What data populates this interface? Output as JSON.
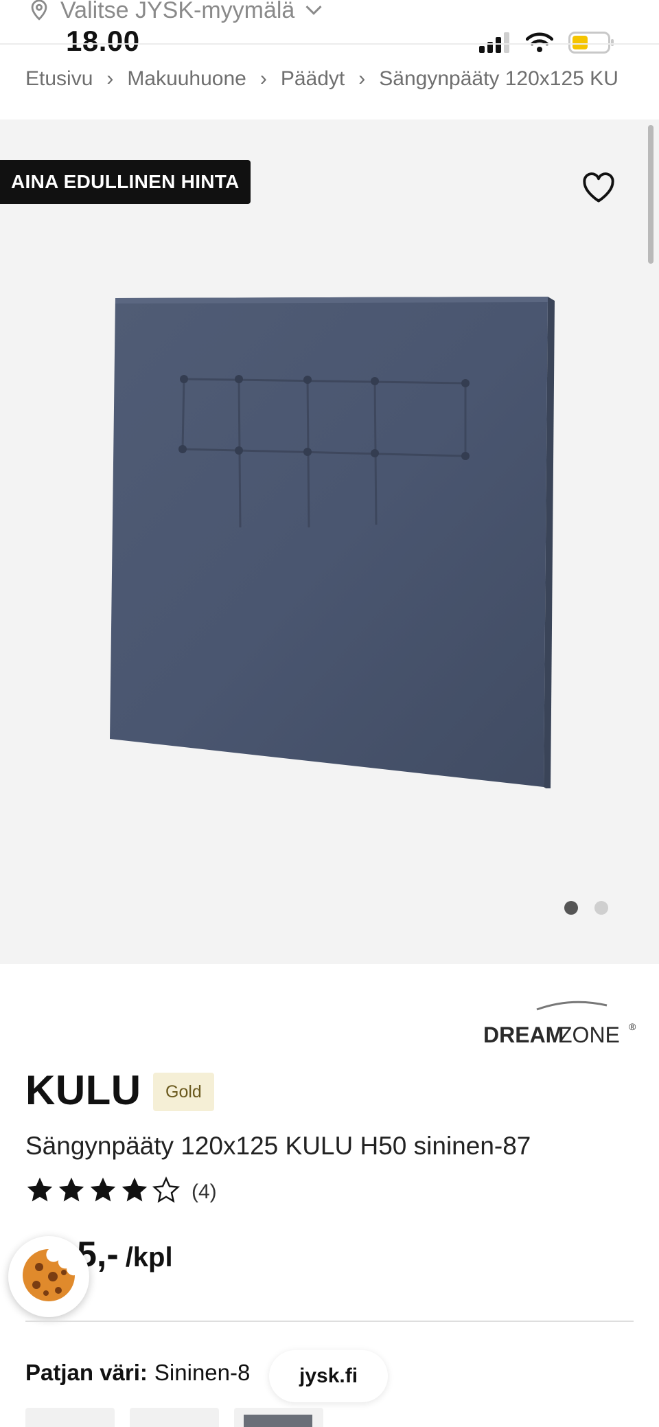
{
  "store": {
    "label": "Valitse JYSK-myymälä"
  },
  "status_bar": {
    "time": "18.00"
  },
  "breadcrumb": {
    "items": [
      "Etusivu",
      "Makuuhuone",
      "Päädyt",
      "Sängynpääty 120x125 KU"
    ],
    "separator": "›"
  },
  "gallery": {
    "badge": "AINA EDULLINEN HINTA",
    "slide_count": 2,
    "active_slide": 1
  },
  "brand": {
    "name_bold": "DREAM",
    "name_light": "ZONE",
    "mark": "®"
  },
  "product": {
    "name": "KULU",
    "tier": "Gold",
    "description": "Sängynpääty 120x125 KULU H50 sininen-87",
    "rating": 4,
    "rating_max": 5,
    "rating_count": "(4)",
    "price": "5,-",
    "price_unit": "/kpl"
  },
  "options": {
    "label": "Patjan väri:",
    "value": "Sininen-8"
  },
  "browser": {
    "url": "jysk.fi"
  },
  "colors": {
    "badge_bg": "#111111",
    "gold_tag_bg": "#f5efd6",
    "product_fabric": "#4a5670"
  }
}
